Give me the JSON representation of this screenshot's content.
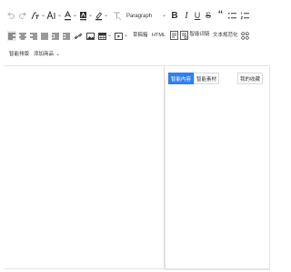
{
  "toolbar": {
    "row1": {
      "undo_icon": "undo-icon",
      "redo_icon": "redo-icon",
      "paragraph_select": "Paragraph"
    },
    "row2": {
      "draft_box": "草稿箱",
      "html": "HTML",
      "smart_words": "智能词链",
      "text_normalize": "文本规范化"
    },
    "row3": {
      "smart_layout": "智能排版",
      "add_product": "添加商品"
    }
  },
  "panel": {
    "tabs": [
      "智能内容",
      "智能素材"
    ],
    "favorite": "我的收藏"
  },
  "colors": {
    "accent": "#2f80ed",
    "border": "#e3e3e3",
    "icon": "#333333"
  }
}
